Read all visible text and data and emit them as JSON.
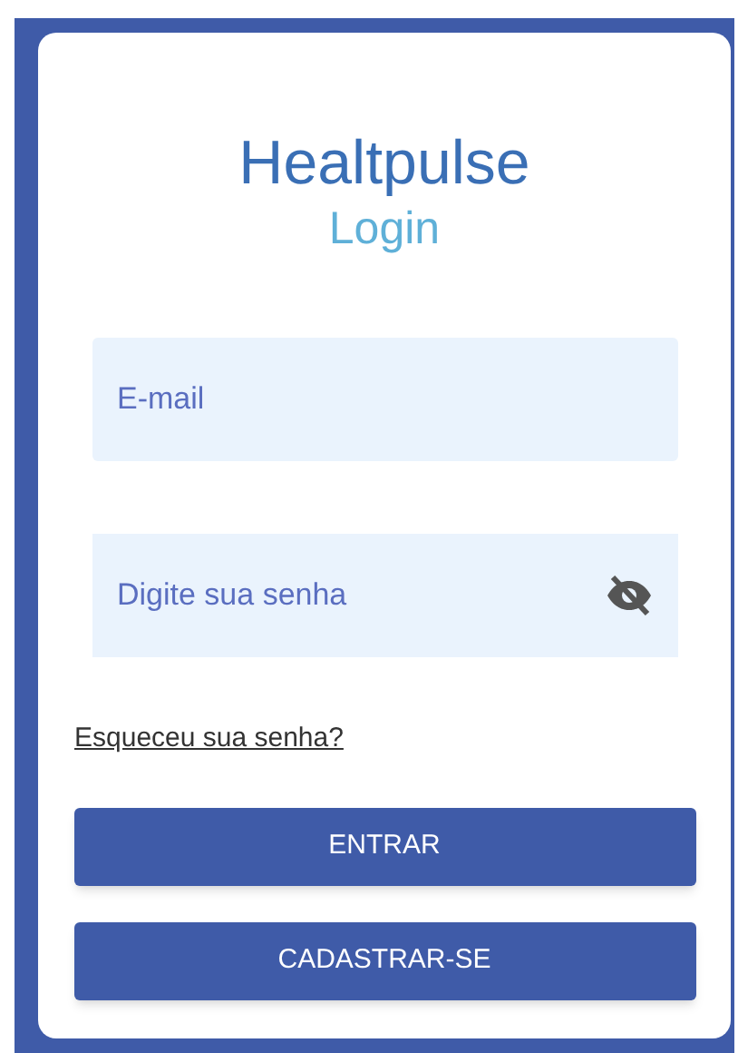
{
  "brand": "Healtpulse",
  "heading": "Login",
  "email_field": {
    "placeholder": "E-mail"
  },
  "password_field": {
    "placeholder": "Digite sua senha"
  },
  "forgot_link": "Esqueceu sua senha?",
  "buttons": [
    "ENTRAR",
    "CADASTRAR-SE"
  ]
}
